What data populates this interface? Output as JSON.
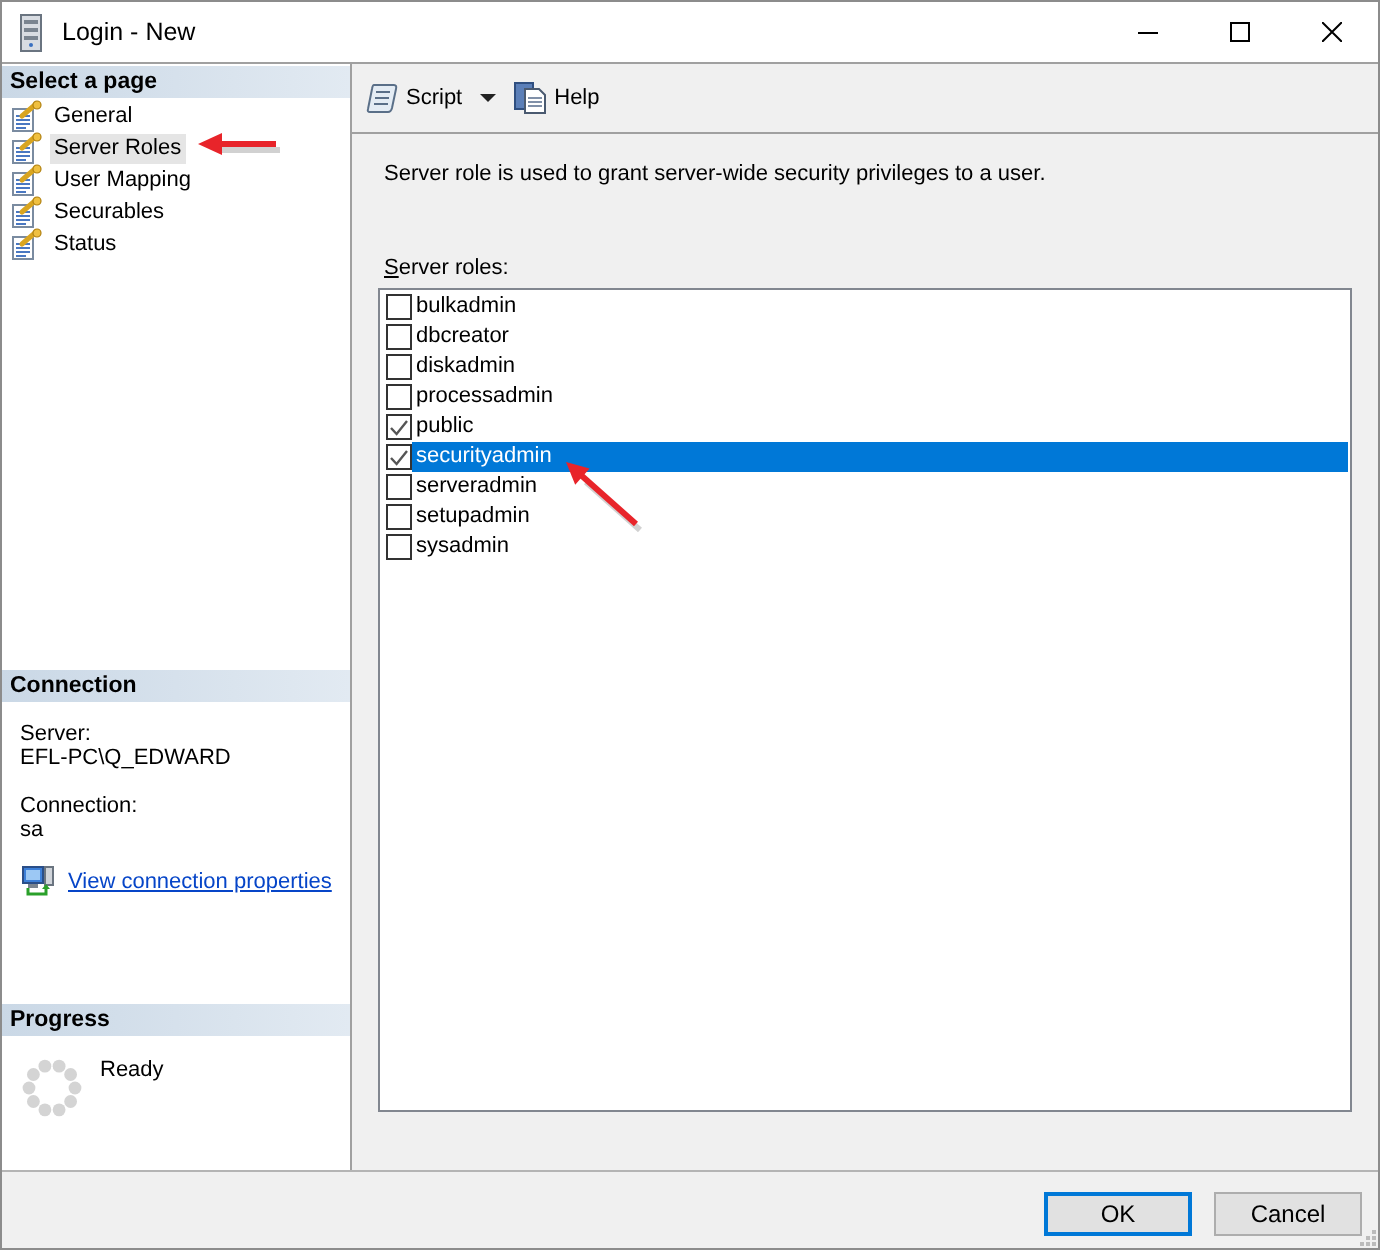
{
  "window": {
    "title": "Login - New"
  },
  "sidebar": {
    "header": "Select a page",
    "items": [
      {
        "label": "General",
        "selected": false
      },
      {
        "label": "Server Roles",
        "selected": true
      },
      {
        "label": "User Mapping",
        "selected": false
      },
      {
        "label": "Securables",
        "selected": false
      },
      {
        "label": "Status",
        "selected": false
      }
    ]
  },
  "connection": {
    "header": "Connection",
    "fields": [
      {
        "label": "Server:",
        "value": "EFL-PC\\Q_EDWARD"
      },
      {
        "label": "Connection:",
        "value": "sa"
      }
    ],
    "link": "View connection properties"
  },
  "progress": {
    "header": "Progress",
    "status": "Ready"
  },
  "toolbar": {
    "items": [
      {
        "kind": "script",
        "label": "Script",
        "dropdown": true
      },
      {
        "kind": "help",
        "label": "Help",
        "dropdown": false
      }
    ]
  },
  "description": "Server role is used to grant server-wide security privileges to a user.",
  "roles": {
    "label": "Server roles:",
    "items": [
      {
        "name": "bulkadmin",
        "checked": false,
        "selected": false
      },
      {
        "name": "dbcreator",
        "checked": false,
        "selected": false
      },
      {
        "name": "diskadmin",
        "checked": false,
        "selected": false
      },
      {
        "name": "processadmin",
        "checked": false,
        "selected": false
      },
      {
        "name": "public",
        "checked": true,
        "selected": false
      },
      {
        "name": "securityadmin",
        "checked": true,
        "selected": true
      },
      {
        "name": "serveradmin",
        "checked": false,
        "selected": false
      },
      {
        "name": "setupadmin",
        "checked": false,
        "selected": false
      },
      {
        "name": "sysadmin",
        "checked": false,
        "selected": false
      }
    ]
  },
  "buttons": [
    {
      "label": "OK",
      "default": true
    },
    {
      "label": "Cancel",
      "default": false
    }
  ]
}
